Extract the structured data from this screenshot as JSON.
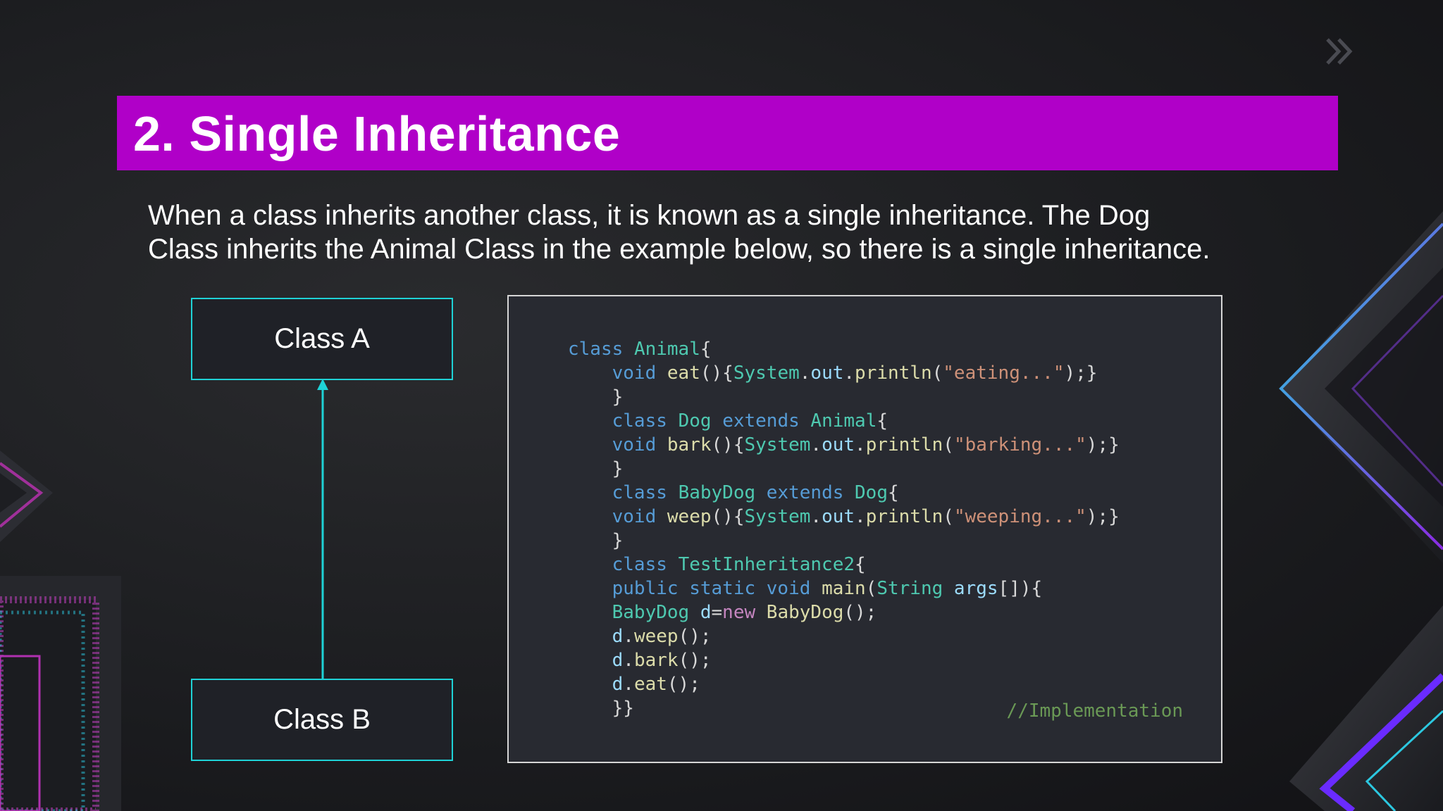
{
  "slide": {
    "title": "2. Single Inheritance",
    "description": [
      "When a class inherits another class, it is known as a single inheritance. The Dog",
      "Class inherits the Animal Class in the example below, so there is a single inheritance."
    ]
  },
  "diagram": {
    "parent_label": "Class A",
    "child_label": "Class B"
  },
  "code": {
    "comment": "//Implementation"
  },
  "colors": {
    "title_bar": "#b000c8",
    "diagram_accent": "#1fd2d6",
    "code_keyword": "#569cd6",
    "code_type": "#4ec9b0",
    "code_string": "#ce9178"
  },
  "icons": {
    "corner": "double-chevron-right-icon"
  }
}
